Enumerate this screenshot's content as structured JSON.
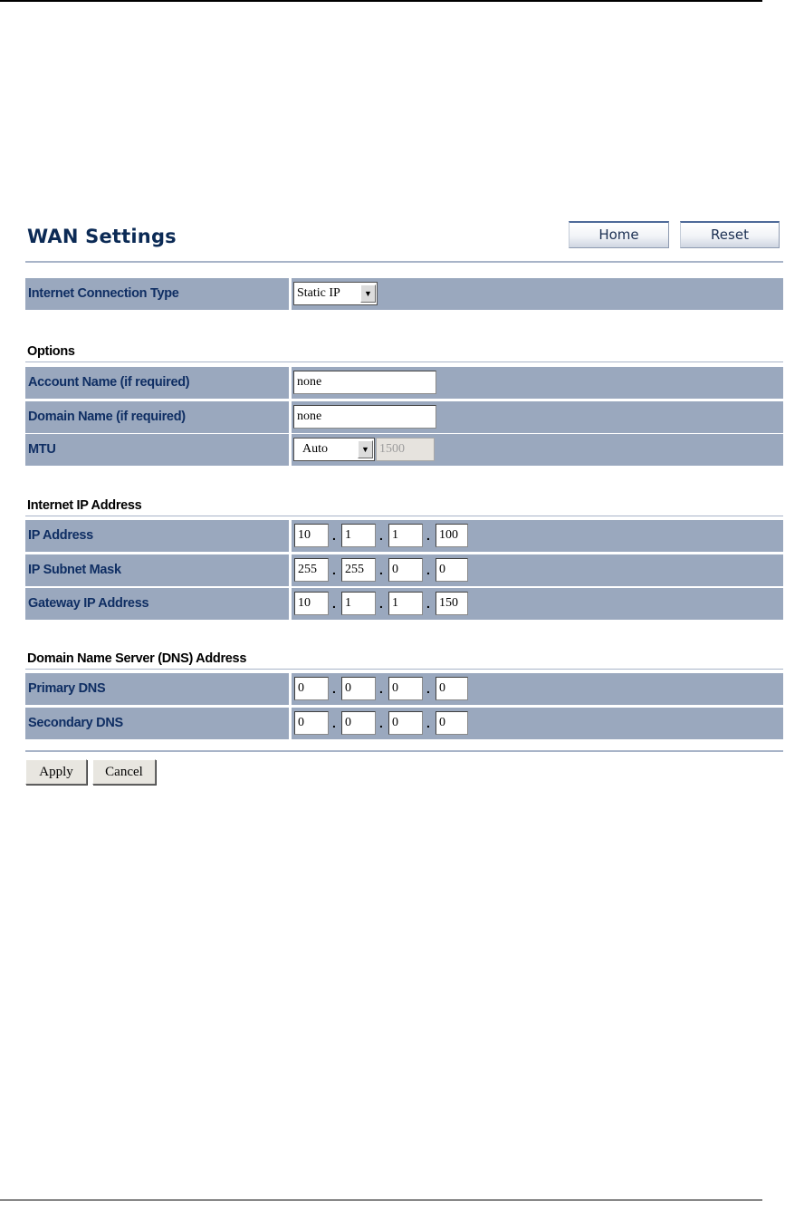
{
  "header": {
    "title": "WAN Settings",
    "home_label": "Home",
    "reset_label": "Reset"
  },
  "connection": {
    "label": "Internet Connection Type",
    "value": "Static IP"
  },
  "options": {
    "heading": "Options",
    "account_label": "Account Name (if required)",
    "account_value": "none",
    "domain_label": "Domain Name (if required)",
    "domain_value": "none",
    "mtu_label": "MTU",
    "mtu_mode": "Auto",
    "mtu_value": "1500"
  },
  "internet_ip": {
    "heading": "Internet IP Address",
    "ip_label": "IP Address",
    "ip": [
      "10",
      "1",
      "1",
      "100"
    ],
    "mask_label": "IP Subnet Mask",
    "mask": [
      "255",
      "255",
      "0",
      "0"
    ],
    "gateway_label": "Gateway IP Address",
    "gateway": [
      "10",
      "1",
      "1",
      "150"
    ]
  },
  "dns": {
    "heading": "Domain Name Server (DNS) Address",
    "primary_label": "Primary DNS",
    "primary": [
      "0",
      "0",
      "0",
      "0"
    ],
    "secondary_label": "Secondary DNS",
    "secondary": [
      "0",
      "0",
      "0",
      "0"
    ]
  },
  "actions": {
    "apply_label": "Apply",
    "cancel_label": "Cancel"
  },
  "ip_separator": "."
}
